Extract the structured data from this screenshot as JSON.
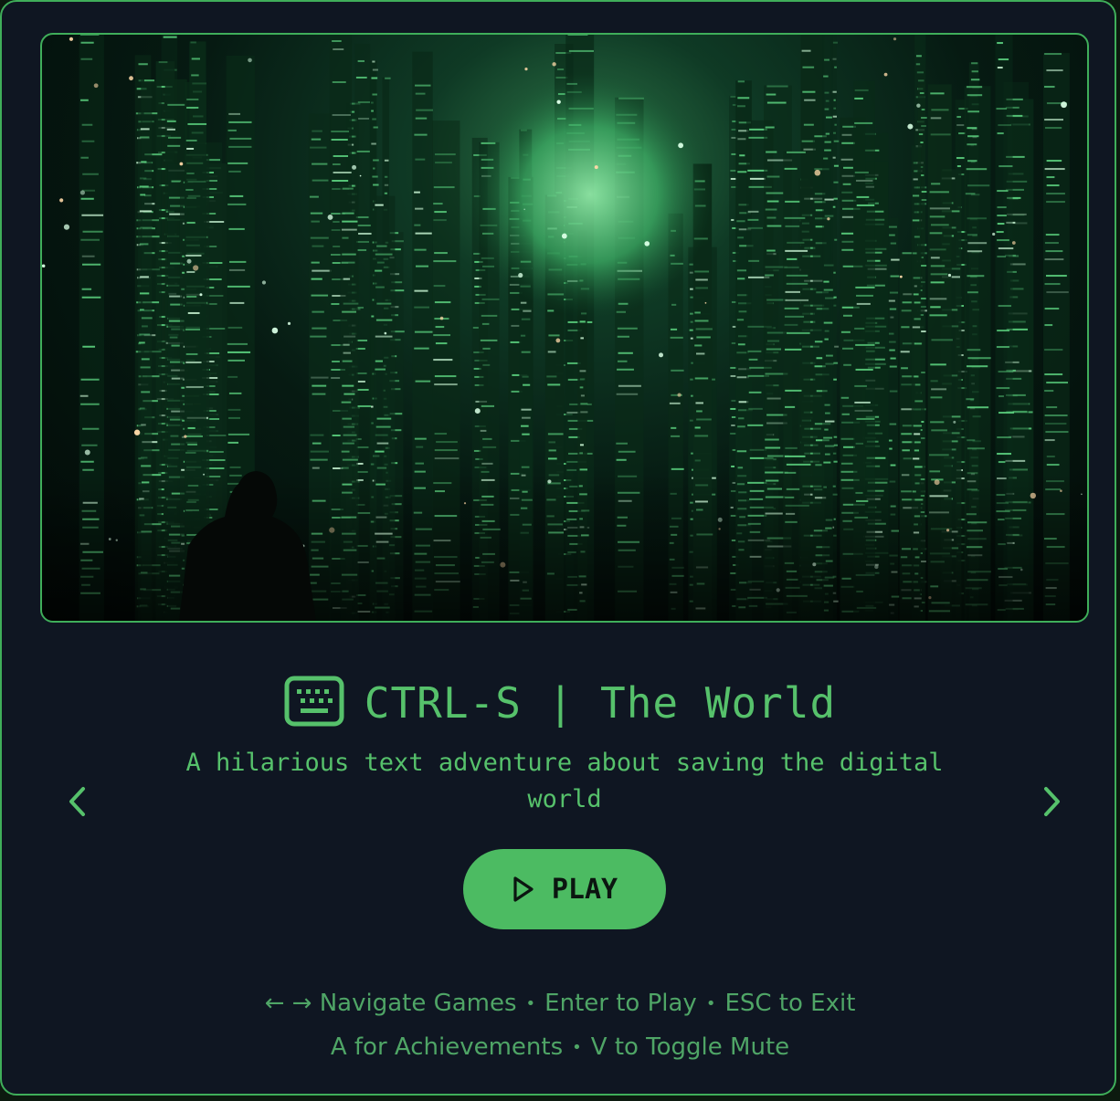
{
  "game": {
    "title": "CTRL-S | The World",
    "description": "A hilarious text adventure about saving the digital world",
    "icon": "keyboard-icon"
  },
  "controls": {
    "prev_icon": "chevron-left-icon",
    "next_icon": "chevron-right-icon",
    "play_label": "PLAY",
    "play_icon": "play-icon"
  },
  "help": {
    "line1": [
      "← → Navigate Games",
      "Enter to Play",
      "ESC to Exit"
    ],
    "line2": [
      "A for Achievements",
      "V to Toggle Mute"
    ]
  },
  "colors": {
    "accent": "#56c16b",
    "button": "#4cbb62",
    "background": "#0f1622",
    "border": "#3fae5a"
  }
}
